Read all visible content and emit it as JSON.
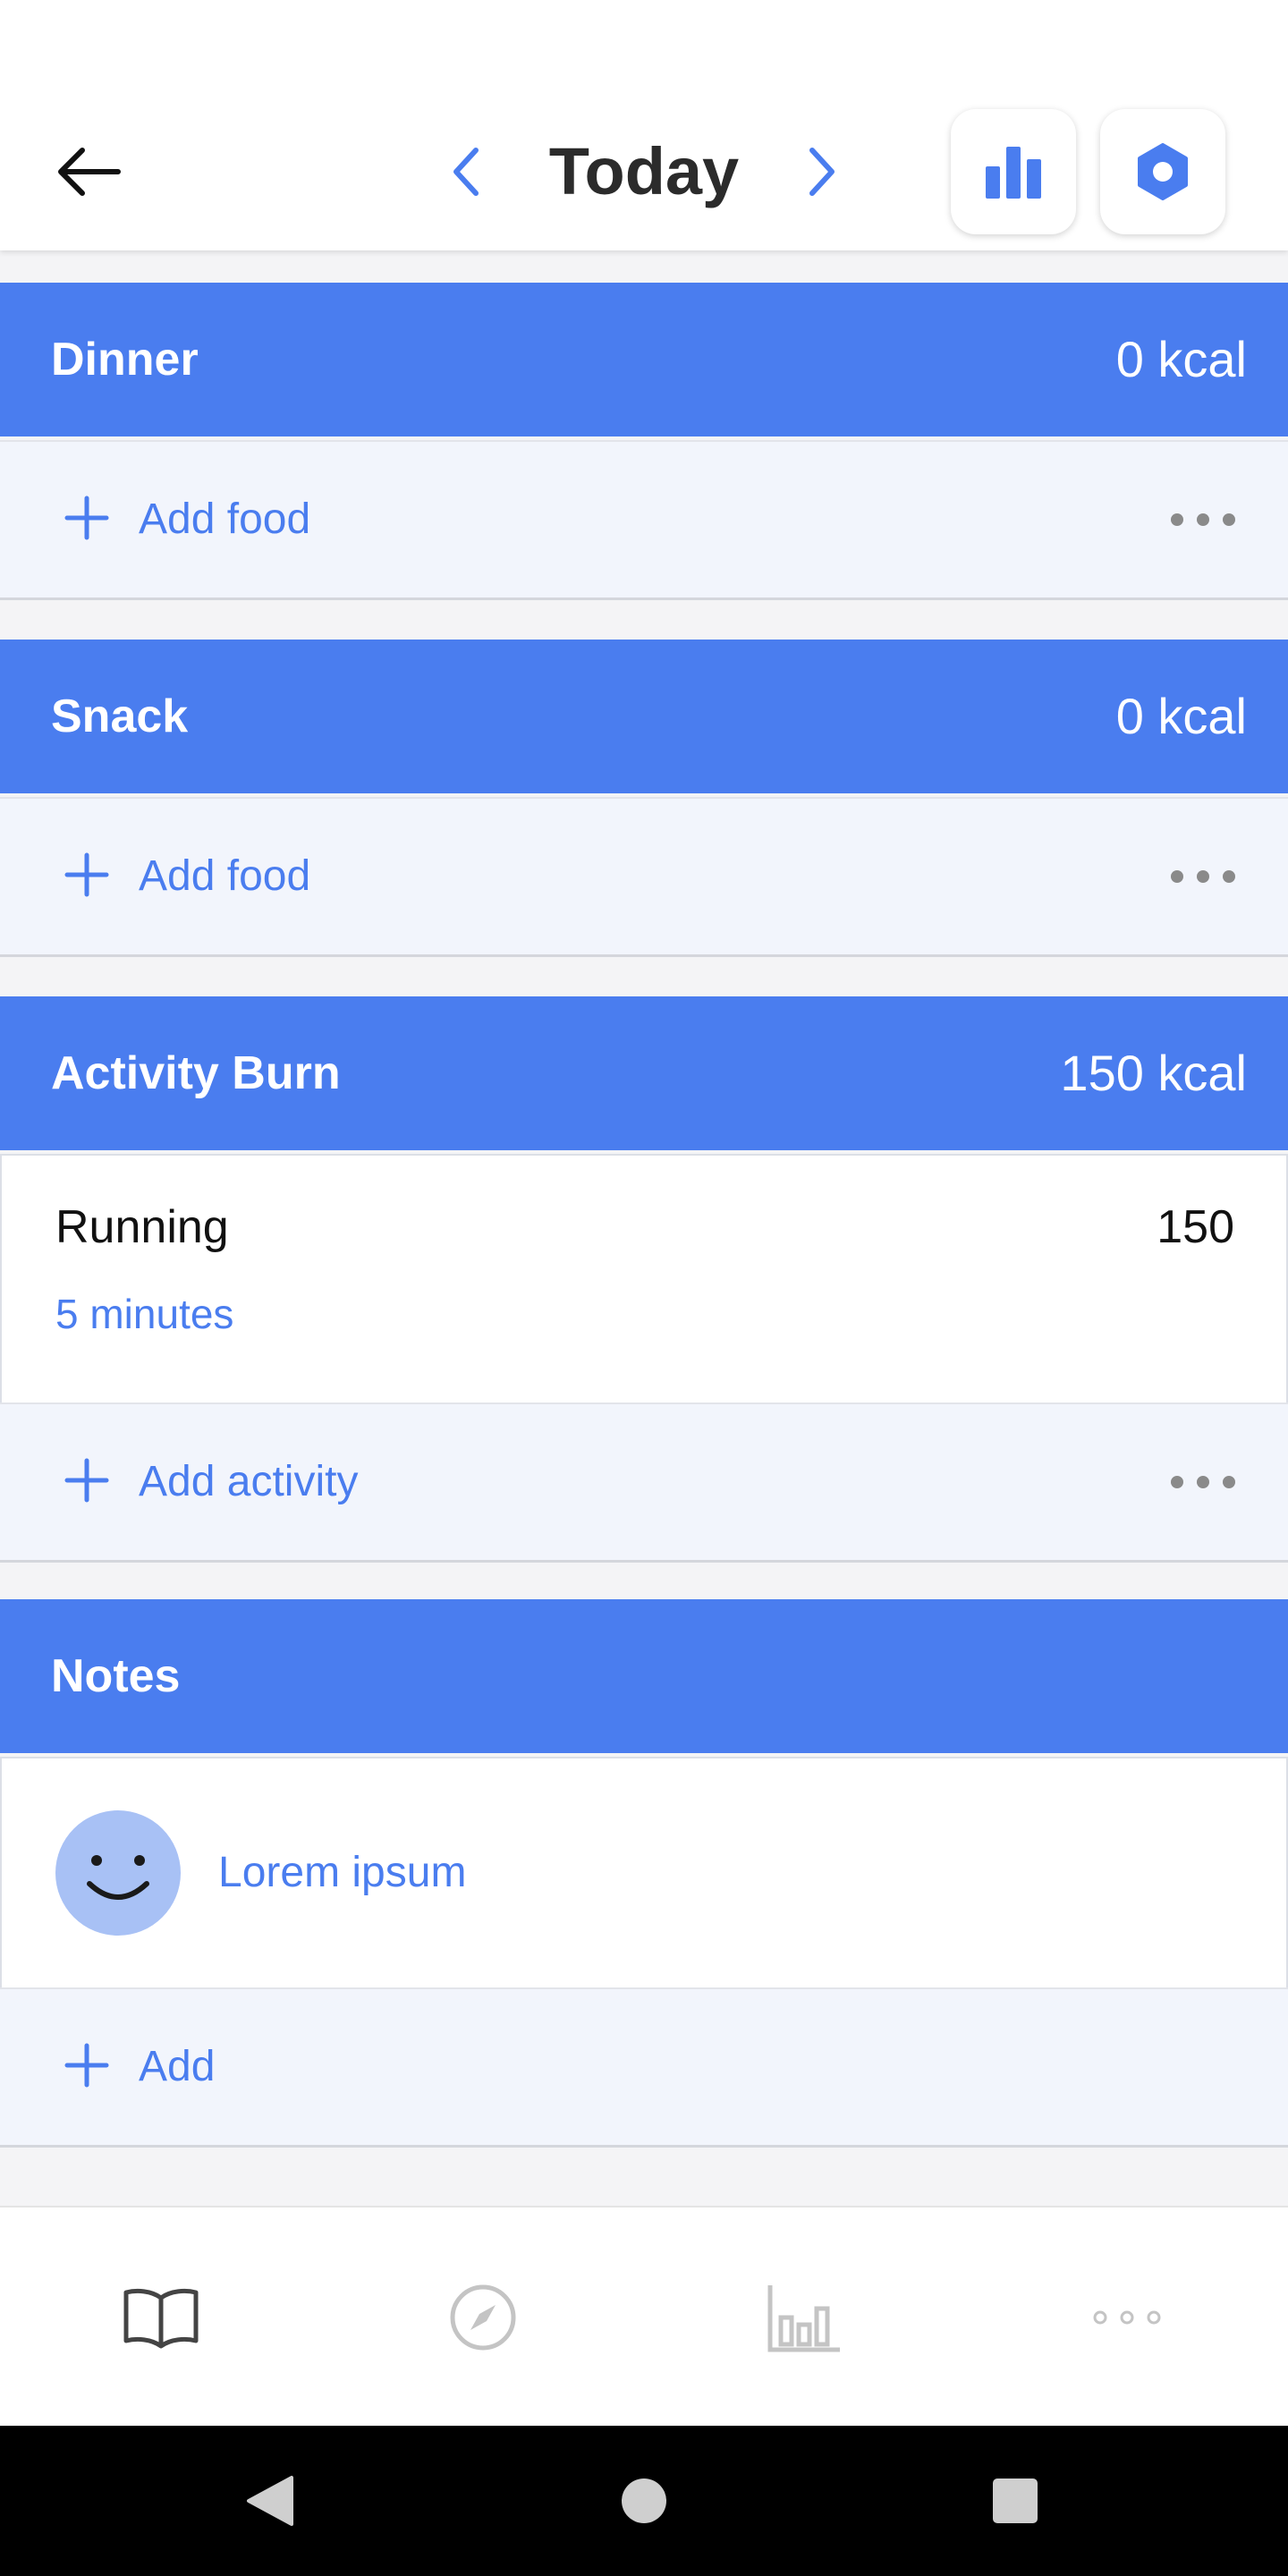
{
  "header": {
    "title": "Today",
    "icons": {
      "back": "arrow-left-icon",
      "prev": "chevron-left-icon",
      "next": "chevron-right-icon",
      "stats": "bar-chart-icon",
      "settings": "hexagon-settings-icon"
    }
  },
  "colors": {
    "accent": "#4a7def",
    "section_bg": "#f2f5fc",
    "avatar": "#a8c1f5"
  },
  "sections": {
    "dinner": {
      "title": "Dinner",
      "kcal": "0 kcal",
      "add_label": "Add food"
    },
    "snack": {
      "title": "Snack",
      "kcal": "0 kcal",
      "add_label": "Add food"
    },
    "activity": {
      "title": "Activity Burn",
      "kcal": "150 kcal",
      "entries": [
        {
          "name": "Running",
          "value": "150",
          "duration": "5 minutes"
        }
      ],
      "add_label": "Add activity"
    },
    "notes": {
      "title": "Notes",
      "entries": [
        {
          "text": "Lorem ipsum",
          "icon": "smiley-face-icon"
        }
      ],
      "add_label": "Add"
    }
  },
  "bottom_nav": {
    "tabs": [
      {
        "icon": "book-icon",
        "active": true
      },
      {
        "icon": "compass-icon",
        "active": false
      },
      {
        "icon": "bar-chart-icon",
        "active": false
      },
      {
        "icon": "more-horizontal-icon",
        "active": false
      }
    ]
  },
  "system_nav": {
    "icons": [
      "back-triangle-icon",
      "home-circle-icon",
      "recents-square-icon"
    ]
  }
}
